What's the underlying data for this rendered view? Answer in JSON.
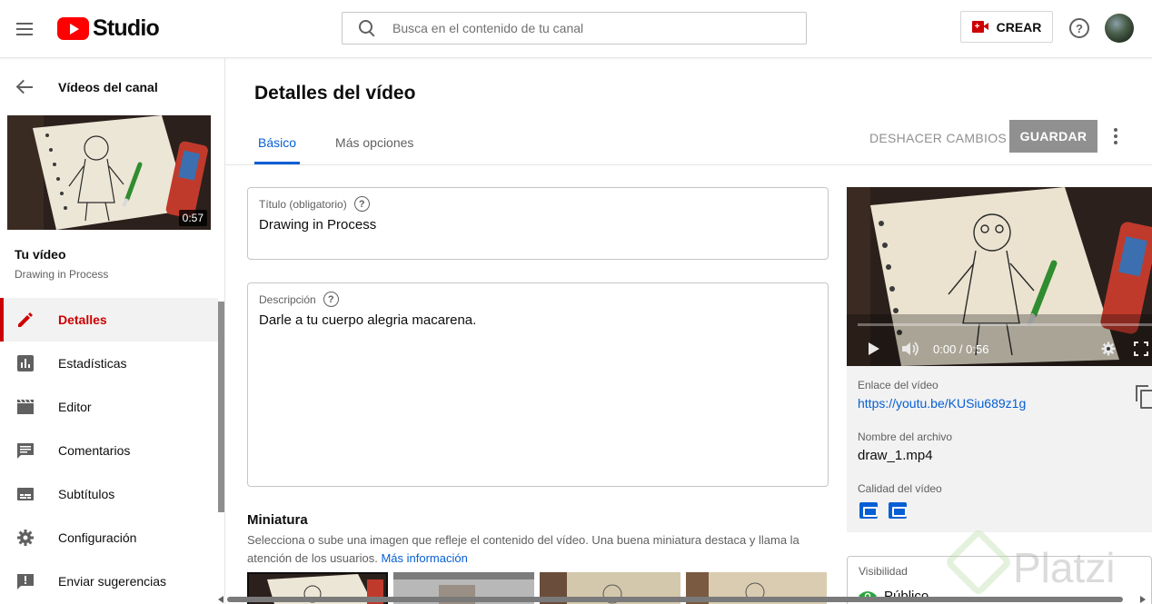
{
  "header": {
    "logo_text": "Studio",
    "search_placeholder": "Busca en el contenido de tu canal",
    "create_label": "CREAR",
    "help_glyph": "?"
  },
  "sidebar": {
    "back_label": "Vídeos del canal",
    "thumbnail_duration": "0:57",
    "your_video_label": "Tu vídeo",
    "video_title": "Drawing in Process",
    "items": [
      {
        "label": "Detalles",
        "icon": "pencil-icon",
        "active": true
      },
      {
        "label": "Estadísticas",
        "icon": "analytics-icon",
        "active": false
      },
      {
        "label": "Editor",
        "icon": "clapperboard-icon",
        "active": false
      },
      {
        "label": "Comentarios",
        "icon": "comment-icon",
        "active": false
      },
      {
        "label": "Subtítulos",
        "icon": "subtitles-icon",
        "active": false
      },
      {
        "label": "Configuración",
        "icon": "gear-icon",
        "active": false
      },
      {
        "label": "Enviar sugerencias",
        "icon": "feedback-icon",
        "active": false
      }
    ]
  },
  "main": {
    "page_title": "Detalles del vídeo",
    "tabs": [
      {
        "label": "Básico",
        "active": true
      },
      {
        "label": "Más opciones",
        "active": false
      }
    ],
    "undo_label": "DESHACER CAMBIOS",
    "save_label": "GUARDAR",
    "title_field": {
      "label": "Título (obligatorio)",
      "value": "Drawing in Process"
    },
    "description_field": {
      "label": "Descripción",
      "value": "Darle a tu cuerpo alegria macarena."
    },
    "thumbnail_section": {
      "title": "Miniatura",
      "description": "Selecciona o sube una imagen que refleje el contenido del vídeo. Una buena miniatura destaca y llama la atención de los usuarios.",
      "more_info_link": "Más información"
    }
  },
  "video_card": {
    "time_display": "0:00 / 0:56",
    "link_label": "Enlace del vídeo",
    "link_value": "https://youtu.be/KUSiu689z1g",
    "filename_label": "Nombre del archivo",
    "filename_value": "draw_1.mp4",
    "quality_label": "Calidad del vídeo",
    "quality_badges": [
      "SD",
      "HD"
    ]
  },
  "visibility": {
    "label": "Visibilidad",
    "value": "Público"
  },
  "watermark": "Platzi",
  "colors": {
    "accent_red": "#cc0000",
    "link_blue": "#065fd4",
    "save_disabled": "#909090",
    "visibility_green": "#2ba640"
  }
}
